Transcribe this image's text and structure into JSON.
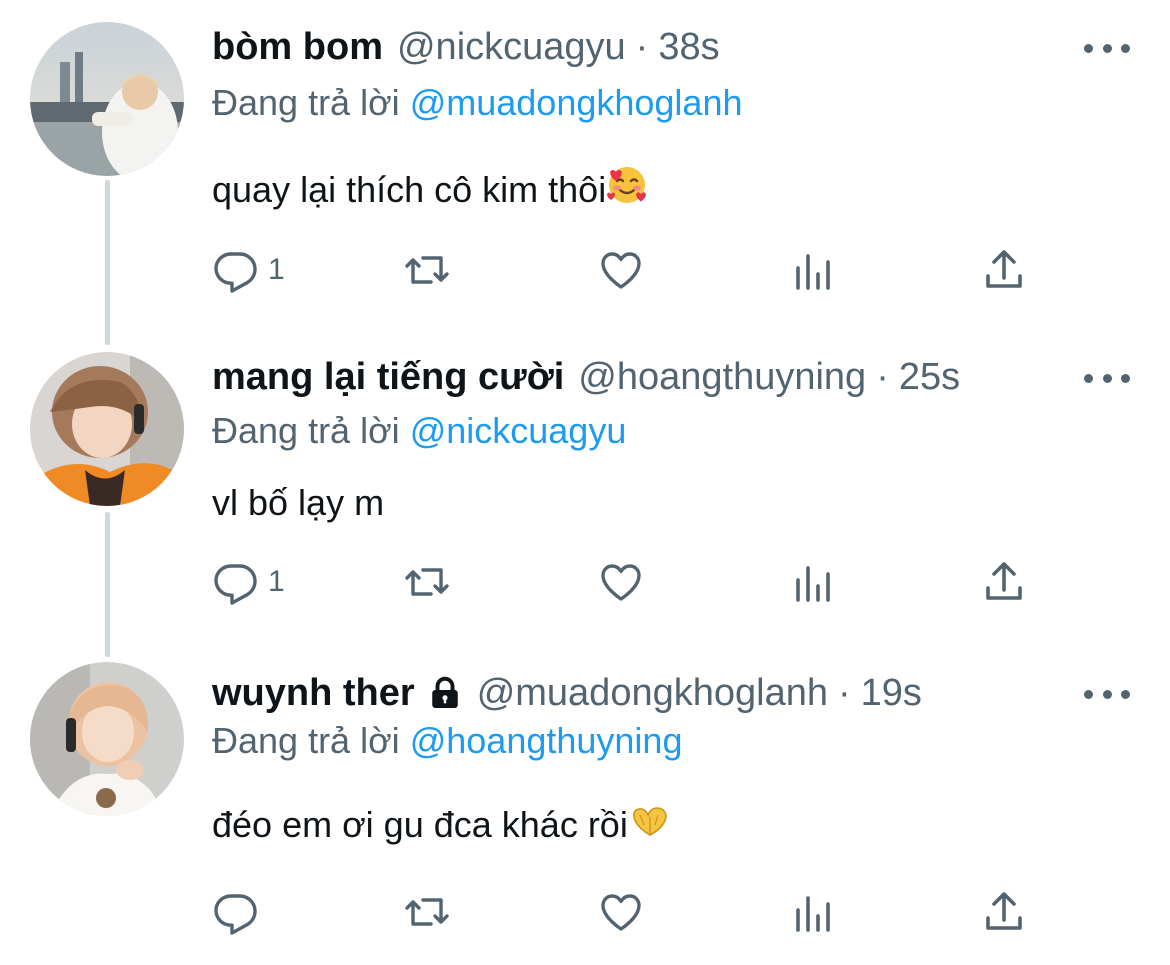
{
  "tweets": [
    {
      "name": "bòm bom",
      "handle": "@nickcuagyu",
      "time": "38s",
      "reply_prefix": "Đang trả lời",
      "reply_to": "@muadongkhoglanh",
      "text": "quay lại thích cô kim thôi",
      "emoji": "smiling-face-with-hearts",
      "reply_count": "1",
      "locked": false
    },
    {
      "name": "mang lại tiếng cười",
      "handle": "@hoangthuyning",
      "time": "25s",
      "reply_prefix": "Đang trả lời",
      "reply_to": "@nickcuagyu",
      "text": "vl bố lạy m",
      "emoji": "",
      "reply_count": "1",
      "locked": false
    },
    {
      "name": "wuynh ther",
      "handle": "@muadongkhoglanh",
      "time": "19s",
      "reply_prefix": "Đang trả lời",
      "reply_to": "@hoangthuyning",
      "text": "đéo em ơi gu đca khác rồi",
      "emoji": "heart-hands",
      "reply_count": "",
      "locked": true
    }
  ],
  "separator": "·",
  "icons": {
    "reply": "reply-icon",
    "retweet": "retweet-icon",
    "like": "heart-icon",
    "views": "views-icon",
    "share": "share-icon",
    "more": "more-icon",
    "lock": "lock-icon"
  },
  "colors": {
    "name": "#0f1419",
    "secondary": "#536471",
    "mention": "#1d9bf0",
    "thread_line": "#cfd9de"
  }
}
